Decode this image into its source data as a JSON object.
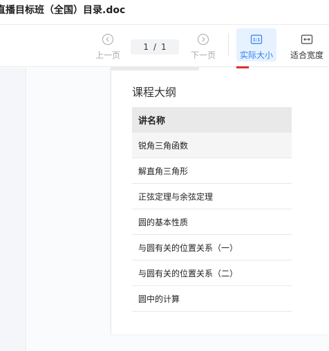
{
  "header": {
    "title": "直播目标班（全国）目录.doc"
  },
  "toolbar": {
    "prev_label": "上一页",
    "current_page": "1",
    "page_separator": "/",
    "total_pages": "1",
    "next_label": "下一页",
    "actual_size_label": "实际大小",
    "actual_size_icon_text": "1:1",
    "fit_width_label": "适合宽度"
  },
  "document": {
    "section_title": "课程大纲",
    "table": {
      "header": "讲名称",
      "rows": [
        "锐角三角函数",
        "解直角三角形",
        "正弦定理与余弦定理",
        "圆的基本性质",
        "与圆有关的位置关系（一）",
        "与圆有关的位置关系（二）",
        "圆中的计算"
      ]
    }
  },
  "colors": {
    "accent": "#2e7ff0",
    "accent_bg": "#e6f2ff",
    "marker": "#e02b2b"
  }
}
